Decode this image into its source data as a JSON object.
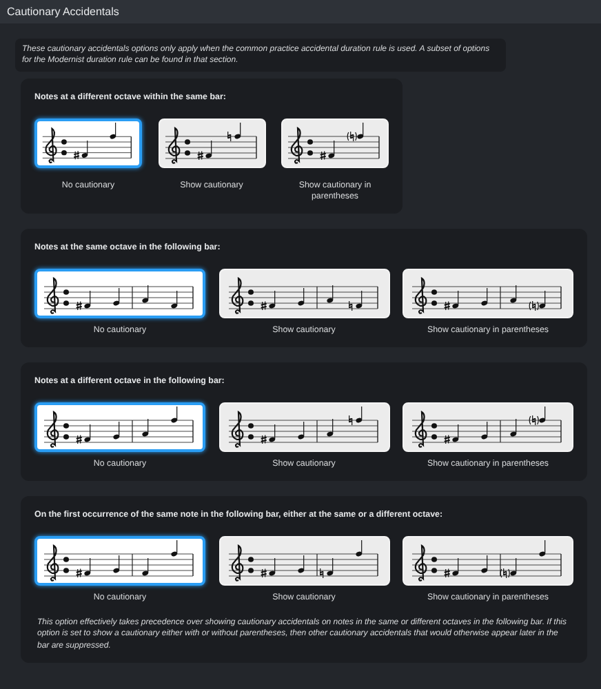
{
  "header": {
    "title": "Cautionary Accidentals"
  },
  "intro": "These cautionary accidentals options only apply when the common practice accidental duration rule is used. A subset of options for the Modernist duration rule can be found in that section.",
  "sections": [
    {
      "title": "Notes at a different octave within the same bar:",
      "kind": "same-bar",
      "options": [
        {
          "label": "No cautionary",
          "kind": "none",
          "selected": true
        },
        {
          "label": "Show cautionary",
          "kind": "cautionary",
          "selected": false
        },
        {
          "label": "Show cautionary in parentheses",
          "kind": "parenthesized",
          "selected": false
        }
      ]
    },
    {
      "title": "Notes at the same octave in the following bar:",
      "kind": "same-octave",
      "options": [
        {
          "label": "No cautionary",
          "kind": "none",
          "selected": true
        },
        {
          "label": "Show cautionary",
          "kind": "cautionary",
          "selected": false
        },
        {
          "label": "Show cautionary in parentheses",
          "kind": "parenthesized",
          "selected": false
        }
      ]
    },
    {
      "title": "Notes at a different octave in the following bar:",
      "kind": "other-octave",
      "options": [
        {
          "label": "No cautionary",
          "kind": "none",
          "selected": true
        },
        {
          "label": "Show cautionary",
          "kind": "cautionary",
          "selected": false
        },
        {
          "label": "Show cautionary in parentheses",
          "kind": "parenthesized",
          "selected": false
        }
      ]
    },
    {
      "title": "On the first occurrence of the same note in the following bar, either at the same or a different octave:",
      "kind": "first-occurrence",
      "options": [
        {
          "label": "No cautionary",
          "kind": "none",
          "selected": true
        },
        {
          "label": "Show cautionary",
          "kind": "cautionary",
          "selected": false
        },
        {
          "label": "Show cautionary in parentheses",
          "kind": "parenthesized",
          "selected": false
        }
      ],
      "note": "This option effectively takes precedence over showing cautionary accidentals on notes in the same or different octaves in the following bar. If this option is set to show a cautionary either with or without parentheses, then other cautionary accidentals that would otherwise appear later in the bar are suppressed."
    }
  ]
}
